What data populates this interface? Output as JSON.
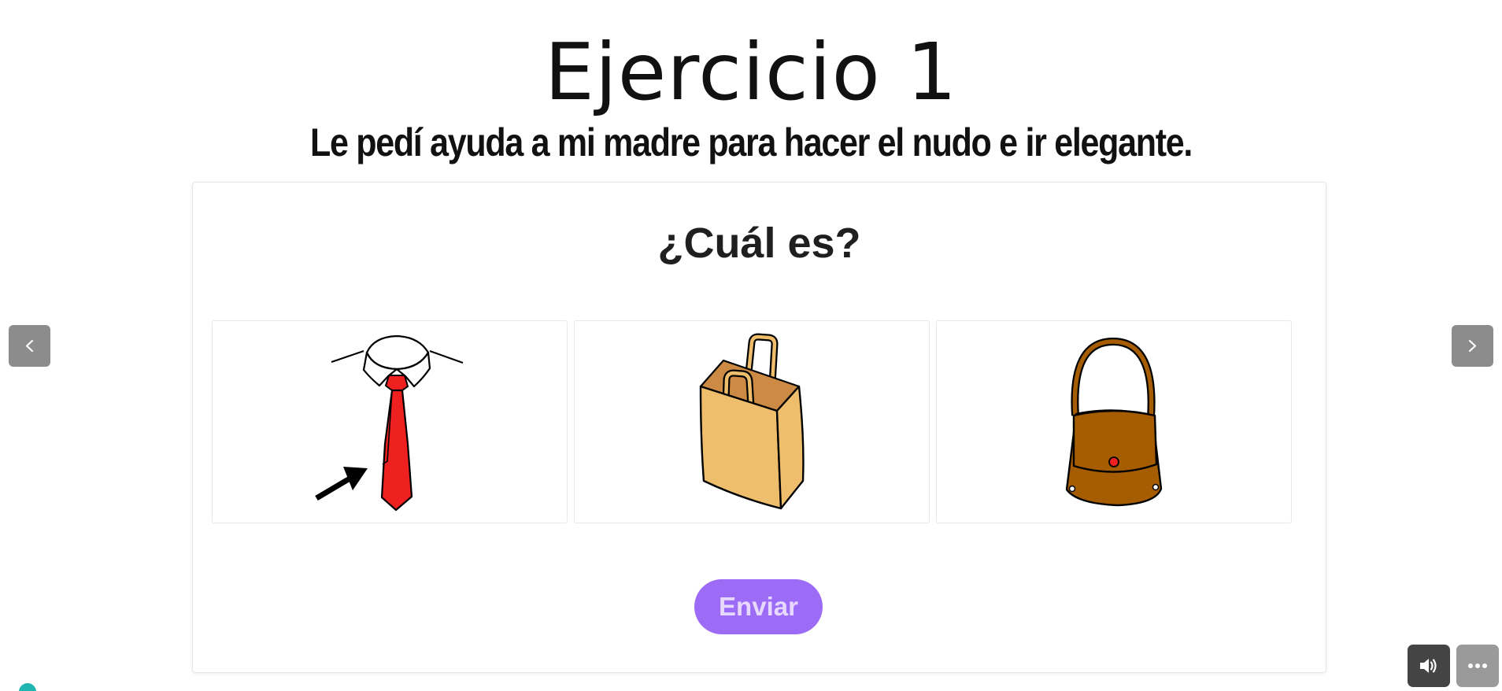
{
  "exercise": {
    "title": "Ejercicio 1",
    "sentence": "Le pedí ayuda a mi madre para hacer el nudo e ir elegante.",
    "question": "¿Cuál es?"
  },
  "options": [
    {
      "icon": "tie-collar-icon"
    },
    {
      "icon": "paper-bag-icon"
    },
    {
      "icon": "handbag-icon"
    }
  ],
  "actions": {
    "send_label": "Enviar"
  },
  "navigation": {
    "prev_icon": "chevron-left-icon",
    "next_icon": "chevron-right-icon"
  },
  "toolbar": {
    "sound_icon": "speaker-icon",
    "more_icon": "more-dots-icon"
  },
  "colors": {
    "accent": "#9d6cf7",
    "accent_text": "#e7d8ff",
    "nav_button": "#8c8c8c",
    "sound_button": "#444444",
    "more_button": "#9a9a9a",
    "tie_red": "#ee2020",
    "bag_tan": "#efbe6c",
    "handbag_brown": "#a65c00"
  }
}
